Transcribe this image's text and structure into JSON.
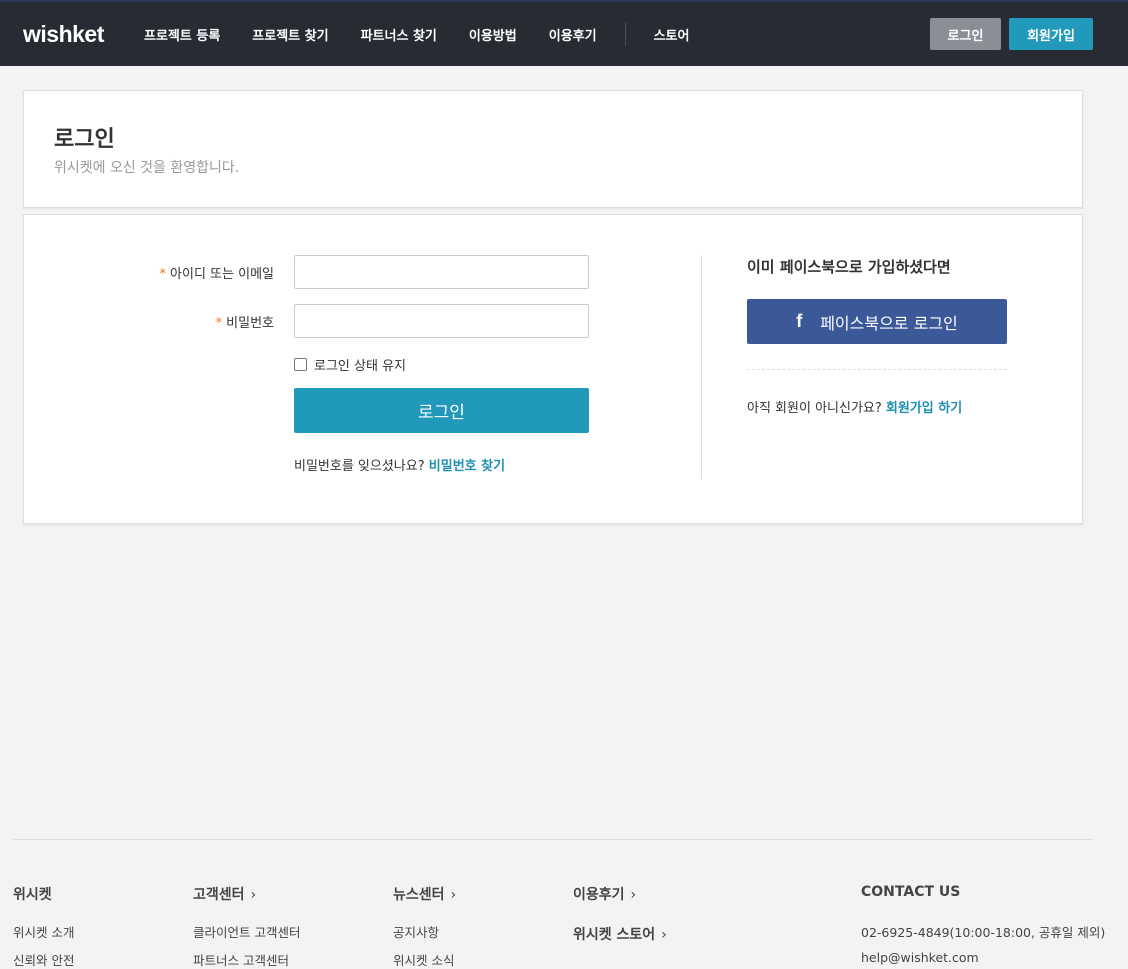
{
  "header": {
    "logo": "wishket",
    "nav": [
      "프로젝트 등록",
      "프로젝트 찾기",
      "파트너스 찾기",
      "이용방법",
      "이용후기"
    ],
    "nav_store": "스토어",
    "login_button": "로그인",
    "signup_button": "회원가입"
  },
  "title_panel": {
    "title": "로그인",
    "subtitle": "위시켓에 오신 것을 환영합니다."
  },
  "login_form": {
    "required_mark": "*",
    "id_label": "아이디 또는 이메일",
    "id_value": "",
    "password_label": "비밀번호",
    "password_value": "",
    "remember_label": "로그인 상태 유지",
    "remember_checked": false,
    "submit_label": "로그인",
    "forgot_text": "비밀번호를 잊으셨나요?",
    "forgot_link": "비밀번호 찾기"
  },
  "facebook": {
    "title": "이미 페이스북으로 가입하셨다면",
    "icon": "facebook-icon",
    "button_label": "페이스북으로 로그인",
    "no_account_text": "아직 회원이 아니신가요?",
    "signup_link": "회원가입 하기"
  },
  "footer": {
    "col1_title": "위시켓",
    "col1_items": [
      "위시켓 소개",
      "신뢰와 안전"
    ],
    "col2_title": "고객센터",
    "col2_items": [
      "클라이언트 고객센터",
      "파트너스 고객센터"
    ],
    "col3_title": "뉴스센터",
    "col3_items": [
      "공지사항",
      "위시켓 소식"
    ],
    "col4_title1": "이용후기",
    "col4_title2": "위시켓 스토어",
    "contact_title": "CONTACT US",
    "contact_phone": "02-6925-4849(10:00-18:00, 공휴일 제외)",
    "contact_email": "help@wishket.com",
    "chevron_icon": "chevron-right-icon"
  },
  "colors": {
    "header_bg": "#262b34",
    "accent": "#2099bb",
    "facebook": "#3b5998",
    "required": "#f0761e"
  }
}
